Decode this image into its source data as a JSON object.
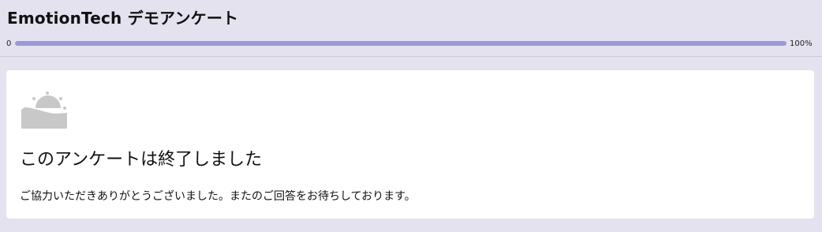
{
  "header": {
    "title": "EmotionTech デモアンケート",
    "progress_start_label": "0",
    "progress_end_label": "100%",
    "progress_value": 1.0
  },
  "card": {
    "icon": "sunset-icon",
    "heading": "このアンケートは終了しました",
    "message": "ご協力いただきありがとうございました。またのご回答をお待ちしております。"
  },
  "colors": {
    "page_background": "#e3e2ee",
    "progress_fill": "#9c98d8",
    "card_background": "#ffffff",
    "icon_gray": "#c8c8c8"
  }
}
